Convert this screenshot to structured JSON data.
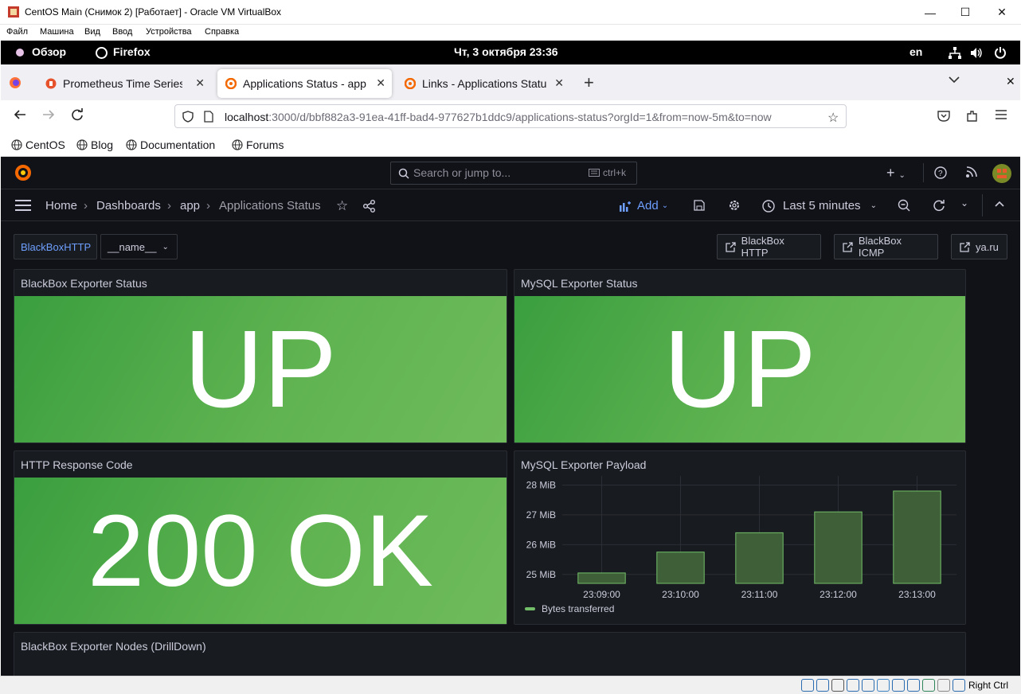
{
  "vbox": {
    "title": "CentOS Main (Снимок 2) [Работает] - Oracle VM VirtualBox",
    "menu": [
      "Файл",
      "Машина",
      "Вид",
      "Ввод",
      "Устройства",
      "Справка"
    ],
    "host_key": "Right Ctrl"
  },
  "gnome": {
    "overview": "Обзор",
    "app": "Firefox",
    "clock": "Чт, 3 октября  23:36",
    "lang": "en"
  },
  "firefox": {
    "tabs": [
      {
        "label": "Prometheus Time Series C",
        "active": false
      },
      {
        "label": "Applications Status - app",
        "active": true
      },
      {
        "label": "Links - Applications Statu",
        "active": false
      }
    ],
    "url_host": "localhost",
    "url_rest": ":3000/d/bbf882a3-91ea-41ff-bad4-977627b1ddc9/applications-status?orgId=1&from=now-5m&to=now",
    "bookmarks": [
      "CentOS",
      "Blog",
      "Documentation",
      "Forums"
    ]
  },
  "grafana": {
    "search_placeholder": "Search or jump to...",
    "search_shortcut": "ctrl+k",
    "breadcrumbs": [
      "Home",
      "Dashboards",
      "app",
      "Applications Status"
    ],
    "add_label": "Add",
    "time_range": "Last 5 minutes",
    "variables": {
      "datasource": "BlackBoxHTTP",
      "name": "__name__"
    },
    "links": [
      "BlackBox HTTP",
      "BlackBox ICMP",
      "ya.ru"
    ],
    "panels": {
      "bb_status": {
        "title": "BlackBox Exporter Status",
        "value": "UP"
      },
      "mysql_status": {
        "title": "MySQL Exporter Status",
        "value": "UP"
      },
      "http_code": {
        "title": "HTTP Response Code",
        "value": "200 OK"
      },
      "payload": {
        "title": "MySQL Exporter Payload"
      },
      "drilldown": {
        "title": "BlackBox Exporter Nodes (DrillDown)"
      }
    },
    "colors": {
      "up": "#56a64b",
      "bg": "#111217",
      "panel": "#181b1f",
      "link": "#6e9fff"
    }
  },
  "chart_data": {
    "type": "bar",
    "title": "MySQL Exporter Payload",
    "categories": [
      "23:09:00",
      "23:10:00",
      "23:11:00",
      "23:12:00",
      "23:13:00"
    ],
    "series": [
      {
        "name": "Bytes transferred",
        "values": [
          25.05,
          25.75,
          26.4,
          27.1,
          27.8
        ]
      }
    ],
    "y_ticks": [
      "25 MiB",
      "26 MiB",
      "27 MiB",
      "28 MiB"
    ],
    "ylim": [
      24.7,
      28.2
    ],
    "ylabel": "",
    "xlabel": "",
    "grid": true,
    "legend": "bottom-left"
  }
}
